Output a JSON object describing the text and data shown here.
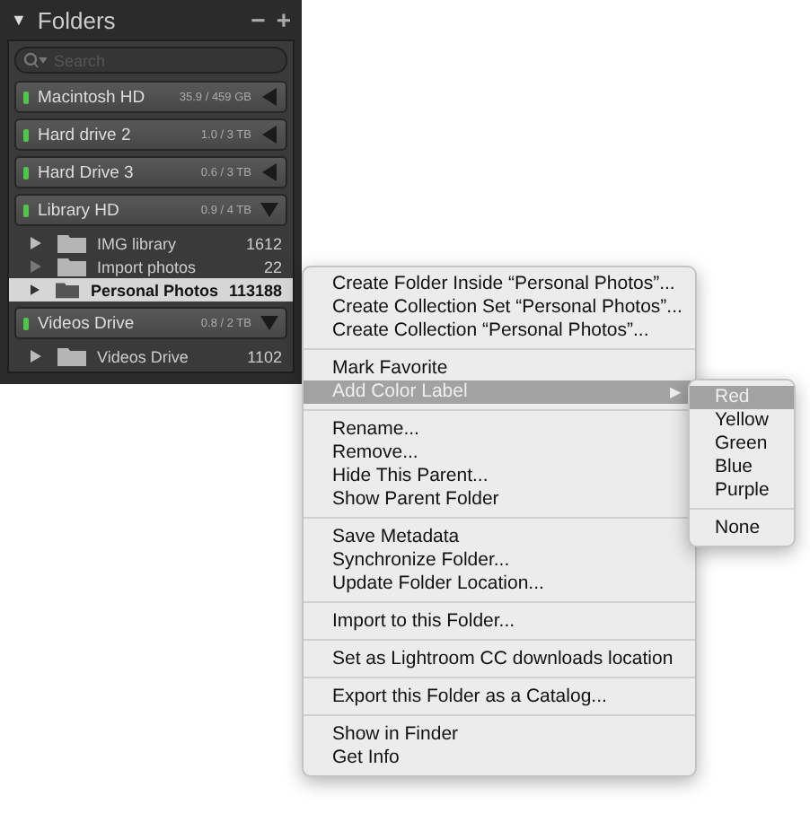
{
  "panel": {
    "title": "Folders",
    "collapse_icon": "▼",
    "minus": "−",
    "plus": "+",
    "search": {
      "placeholder": "Search"
    },
    "drives": [
      {
        "name": "Macintosh HD",
        "usage": "35.9 / 459 GB",
        "expanded": false
      },
      {
        "name": "Hard drive 2",
        "usage": "1.0 / 3 TB",
        "expanded": false
      },
      {
        "name": "Hard Drive 3",
        "usage": "0.6 / 3 TB",
        "expanded": false
      },
      {
        "name": "Library HD",
        "usage": "0.9 / 4 TB",
        "expanded": true,
        "children": [
          {
            "name": "IMG library",
            "count": "1612",
            "expandable": true,
            "selected": false
          },
          {
            "name": "Import photos",
            "count": "22",
            "expandable": false,
            "selected": false
          },
          {
            "name": "Personal Photos",
            "count": "113188",
            "expandable": true,
            "selected": true
          }
        ]
      },
      {
        "name": "Videos Drive",
        "usage": "0.8 / 2 TB",
        "expanded": true,
        "children": [
          {
            "name": "Videos Drive",
            "count": "1102",
            "expandable": true,
            "selected": false
          }
        ]
      }
    ]
  },
  "context_menu": {
    "groups": [
      [
        {
          "label": "Create Folder Inside “Personal Photos”...",
          "selected": false
        },
        {
          "label": "Create Collection Set “Personal Photos”...",
          "selected": false
        },
        {
          "label": "Create Collection “Personal Photos”...",
          "selected": false
        }
      ],
      [
        {
          "label": "Mark Favorite",
          "selected": false
        },
        {
          "label": "Add Color Label",
          "selected": true,
          "arrow": "▶"
        }
      ],
      [
        {
          "label": "Rename...",
          "selected": false
        },
        {
          "label": "Remove...",
          "selected": false
        },
        {
          "label": "Hide This Parent...",
          "selected": false
        },
        {
          "label": "Show Parent Folder",
          "selected": false
        }
      ],
      [
        {
          "label": "Save Metadata",
          "selected": false
        },
        {
          "label": "Synchronize Folder...",
          "selected": false
        },
        {
          "label": "Update Folder Location...",
          "selected": false
        }
      ],
      [
        {
          "label": "Import to this Folder...",
          "selected": false
        }
      ],
      [
        {
          "label": "Set as Lightroom CC downloads location",
          "selected": false
        }
      ],
      [
        {
          "label": "Export this Folder as a Catalog...",
          "selected": false
        }
      ],
      [
        {
          "label": "Show in Finder",
          "selected": false
        },
        {
          "label": "Get Info",
          "selected": false
        }
      ]
    ]
  },
  "submenu": {
    "groups": [
      [
        {
          "label": "Red",
          "selected": true
        },
        {
          "label": "Yellow",
          "selected": false
        },
        {
          "label": "Green",
          "selected": false
        },
        {
          "label": "Blue",
          "selected": false
        },
        {
          "label": "Purple",
          "selected": false
        }
      ],
      [
        {
          "label": "None",
          "selected": false
        }
      ]
    ]
  }
}
